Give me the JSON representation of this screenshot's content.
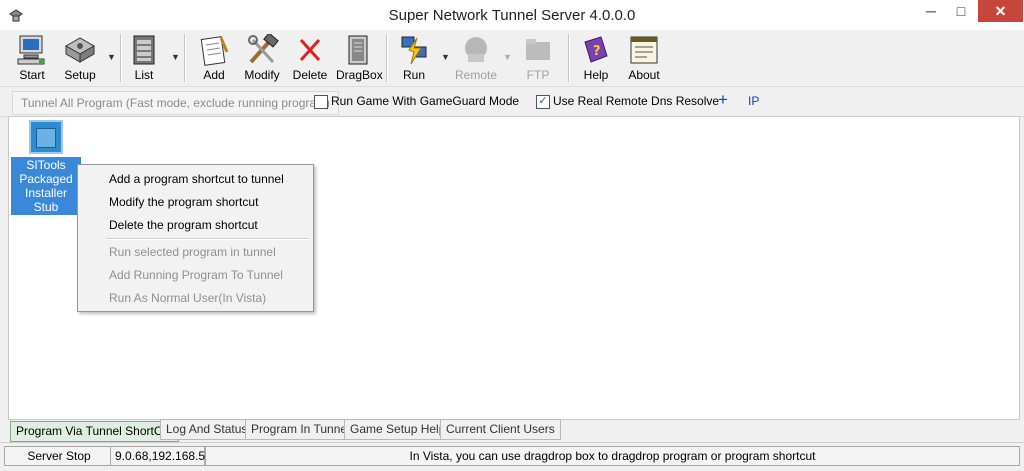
{
  "window": {
    "title": "Super Network Tunnel Server 4.0.0.0",
    "min": "─",
    "max": "□",
    "close": "✕"
  },
  "toolbar": {
    "start": "Start",
    "setup": "Setup",
    "list": "List",
    "add": "Add",
    "modify": "Modify",
    "delete": "Delete",
    "dragbox": "DragBox",
    "run": "Run",
    "remote": "Remote",
    "ftp": "FTP",
    "help": "Help",
    "about": "About",
    "arrow": "▼"
  },
  "options": {
    "tunnel_all": "Tunnel All Program (Fast mode, exclude running program)",
    "gameguard_label": "Run Game With GameGuard Mode",
    "gameguard_checked": false,
    "dns_label": "Use Real Remote Dns Resolve",
    "dns_checked": true,
    "plus": "+",
    "ip": "IP"
  },
  "shortcut": {
    "label": "SITools Packaged Installer Stub"
  },
  "context_menu": {
    "items": [
      "Add a program shortcut to tunnel",
      "Modify the program shortcut",
      "Delete the program shortcut",
      "Run selected program in tunnel",
      "Add Running Program To Tunnel",
      "Run As Normal User(In Vista)"
    ]
  },
  "tabs": [
    "Program Via Tunnel ShortCut",
    "Log And Status",
    "Program In Tunnel",
    "Game Setup Help",
    "Current Client Users"
  ],
  "status": {
    "server": "Server Stop",
    "ip": "9.0.68,192.168.5",
    "hint": "In Vista, you can use dragdrop box to dragdrop program or program shortcut"
  }
}
